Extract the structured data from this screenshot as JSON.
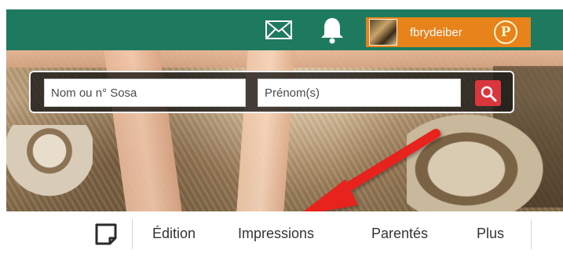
{
  "topbar": {
    "username": "fbrydeiber",
    "premium_badge": "P",
    "icons": [
      "mail-icon",
      "bell-icon"
    ],
    "background_color": "#1e7a5f",
    "user_chip_color": "#e8821a"
  },
  "search": {
    "name_placeholder": "Nom ou n° Sosa",
    "firstname_placeholder": "Prénom(s)",
    "button_icon": "search-icon",
    "button_color": "#d9363e"
  },
  "nav": {
    "note_icon": "note-icon",
    "items": [
      {
        "label": "Édition"
      },
      {
        "label": "Impressions"
      },
      {
        "label": "Parentés"
      },
      {
        "label": "Plus"
      }
    ]
  },
  "annotation": {
    "arrow_color": "#e8221e",
    "points_to": "Impressions"
  }
}
